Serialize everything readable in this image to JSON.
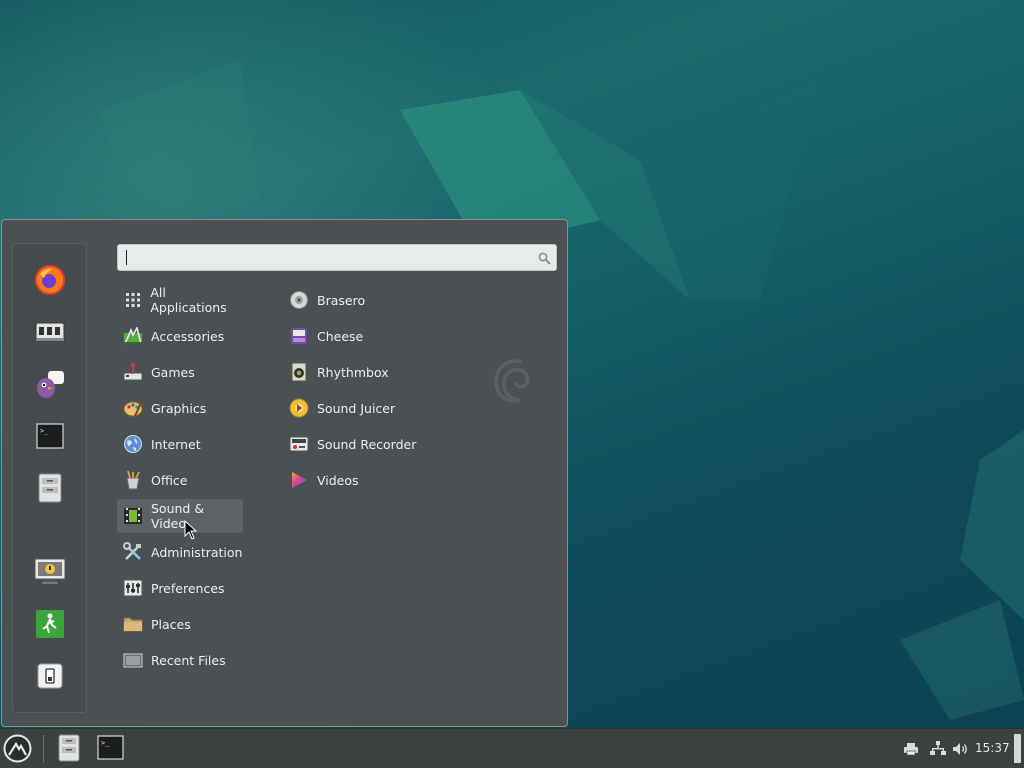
{
  "search": {
    "value": "",
    "placeholder": ""
  },
  "favorites": [
    {
      "name": "firefox-icon"
    },
    {
      "name": "software-center-icon"
    },
    {
      "name": "pidgin-icon"
    },
    {
      "name": "terminal-icon"
    },
    {
      "name": "file-manager-icon"
    },
    {
      "name": "lock-screen-icon"
    },
    {
      "name": "logout-icon"
    },
    {
      "name": "shutdown-icon"
    }
  ],
  "categories": [
    {
      "label": "All Applications",
      "icon": "grid-icon"
    },
    {
      "label": "Accessories",
      "icon": "accessories-icon"
    },
    {
      "label": "Games",
      "icon": "games-icon"
    },
    {
      "label": "Graphics",
      "icon": "graphics-icon"
    },
    {
      "label": "Internet",
      "icon": "internet-icon"
    },
    {
      "label": "Office",
      "icon": "office-icon"
    },
    {
      "label": "Sound & Video",
      "icon": "sound-video-icon"
    },
    {
      "label": "Administration",
      "icon": "administration-icon"
    },
    {
      "label": "Preferences",
      "icon": "preferences-icon"
    },
    {
      "label": "Places",
      "icon": "folder-icon"
    },
    {
      "label": "Recent Files",
      "icon": "recent-files-icon"
    }
  ],
  "selected_category": "Sound & Video",
  "apps": [
    {
      "label": "Brasero",
      "icon": "brasero-icon"
    },
    {
      "label": "Cheese",
      "icon": "cheese-icon"
    },
    {
      "label": "Rhythmbox",
      "icon": "rhythmbox-icon"
    },
    {
      "label": "Sound Juicer",
      "icon": "sound-juicer-icon"
    },
    {
      "label": "Sound Recorder",
      "icon": "sound-recorder-icon"
    },
    {
      "label": "Videos",
      "icon": "videos-icon"
    }
  ],
  "panel": {
    "clock": "15:37"
  },
  "colors": {
    "menu_bg": "#4b5152",
    "panel_bg": "#3c4142",
    "selection": "#5d6364"
  }
}
